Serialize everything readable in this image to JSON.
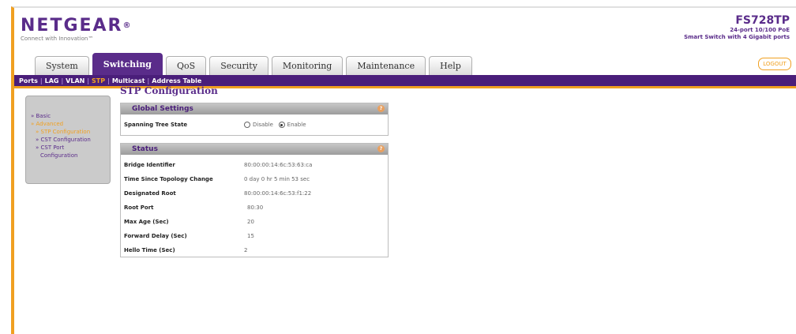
{
  "header": {
    "brand": "NETGEAR",
    "brand_mark": "®",
    "tagline": "Connect with Innovation™",
    "model": "FS728TP",
    "desc_line1": "24-port 10/100 PoE",
    "desc_line2": "Smart Switch with 4 Gigabit ports",
    "logout_label": "LOGOUT"
  },
  "tabs": [
    {
      "label": "System"
    },
    {
      "label": "Switching"
    },
    {
      "label": "QoS"
    },
    {
      "label": "Security"
    },
    {
      "label": "Monitoring"
    },
    {
      "label": "Maintenance"
    },
    {
      "label": "Help"
    }
  ],
  "subnav": [
    {
      "label": "Ports"
    },
    {
      "label": "LAG"
    },
    {
      "label": "VLAN"
    },
    {
      "label": "STP"
    },
    {
      "label": "Multicast"
    },
    {
      "label": "Address Table"
    }
  ],
  "leftmenu": {
    "basic": "» Basic",
    "advanced": "» Advanced",
    "stp_config": "» STP Configuration",
    "cst_config": "» CST Configuration",
    "cst_port_1": "» CST Port",
    "cst_port_2": "Configuration"
  },
  "page": {
    "title": "STP Configuration"
  },
  "global": {
    "heading": "Global Settings",
    "help": "?",
    "spanning_tree_label": "Spanning Tree State",
    "disable_label": "Disable",
    "enable_label": "Enable",
    "selected": "Enable"
  },
  "status": {
    "heading": "Status",
    "help": "?",
    "rows": [
      {
        "label": "Bridge Identifier",
        "value": "80:00:00:14:6c:53:63:ca"
      },
      {
        "label": "Time Since Topology Change",
        "value": "0 day 0 hr 5 min 53 sec"
      },
      {
        "label": "Designated Root",
        "value": "80:00:00:14:6c:53:f1:22"
      },
      {
        "label": "Root Port",
        "value": "80:30"
      },
      {
        "label": "Max Age (Sec)",
        "value": "20"
      },
      {
        "label": "Forward Delay (Sec)",
        "value": "15"
      },
      {
        "label": "Hello Time (Sec)",
        "value": "2"
      }
    ]
  },
  "colors": {
    "brand_purple": "#5a2c8a",
    "accent_orange": "#f0a021"
  }
}
